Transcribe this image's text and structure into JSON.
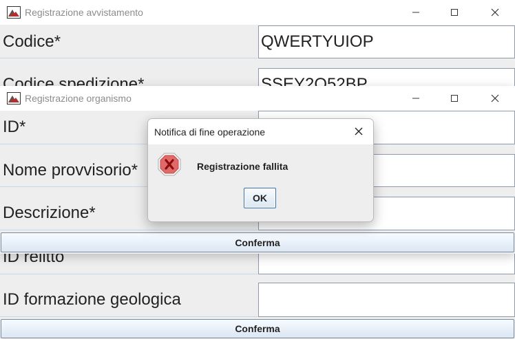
{
  "back_window": {
    "title": "Registrazione avvistamento",
    "fields": [
      {
        "label": "Codice*",
        "value": "QWERTYUIOP"
      },
      {
        "label": "Codice spedizione*",
        "value": "SSEY2Q52BP"
      },
      {
        "label": "ID relitto",
        "value": ""
      },
      {
        "label": "ID formazione geologica",
        "value": ""
      }
    ],
    "confirm_label": "Conferma"
  },
  "front_window": {
    "title": "Registrazione organismo",
    "fields": [
      {
        "label": "ID*",
        "value": ""
      },
      {
        "label": "Nome provvisorio*",
        "value": ""
      },
      {
        "label": "Descrizione*",
        "value": ""
      }
    ],
    "confirm_label": "Conferma"
  },
  "dialog": {
    "title": "Notifica di fine operazione",
    "message": "Registrazione fallita",
    "ok_label": "OK",
    "icon": "error-icon"
  },
  "icons": {
    "app": "java-app-icon",
    "minimize": "minimize-icon",
    "maximize": "maximize-icon",
    "close": "close-icon"
  },
  "colors": {
    "error_red": "#d93a3a",
    "button_border": "#3d6fa8",
    "panel_bg": "#eeeeee"
  }
}
